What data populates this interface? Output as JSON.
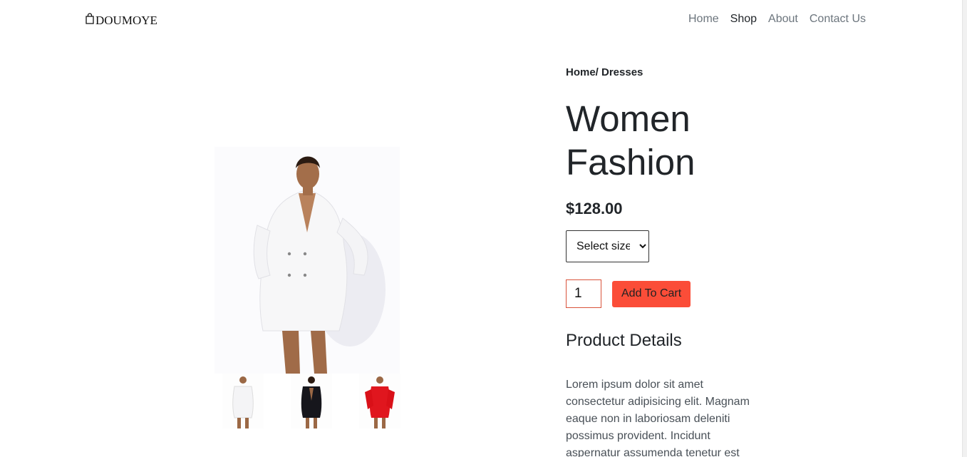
{
  "brand": {
    "name": "DOUMOYE",
    "icon": "shopping-bag-icon"
  },
  "nav": {
    "home": "Home",
    "shop": "Shop",
    "about": "About",
    "contact": "Contact Us",
    "active": "Shop"
  },
  "product": {
    "breadcrumb": "Home/ Dresses",
    "title": "Women Fashion",
    "price": "$128.00",
    "size_select": {
      "selected": "Select size"
    },
    "quantity": "1",
    "add_to_cart": "Add To Cart",
    "details_heading": "Product Details",
    "description": "Lorem ipsum dolor sit amet consectetur adipisicing elit. Magnam eaque non in laboriosam deleniti possimus provident. Incidunt aspernatur assumenda tenetur est"
  },
  "colors": {
    "accent": "#fb4d38",
    "qty_border": "#d9533b",
    "nav_muted": "#6c757d"
  }
}
